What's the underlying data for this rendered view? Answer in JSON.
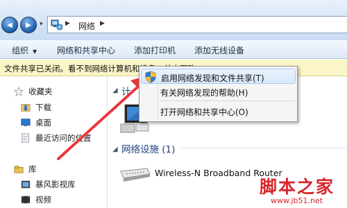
{
  "address_bar": {
    "back_glyph": "◀",
    "forward_glyph": "▶",
    "dropdown_glyph": "▾",
    "location_icon": "network-icon",
    "crumbs": [
      "网络"
    ],
    "separator": "▶"
  },
  "toolbar": {
    "items": [
      {
        "label": "组织",
        "has_dropdown": true
      },
      {
        "label": "网络和共享中心"
      },
      {
        "label": "添加打印机"
      },
      {
        "label": "添加无线设备"
      }
    ],
    "dropdown_glyph": "▼"
  },
  "infobar": {
    "text": "文件共享已关闭。看不到网络计算机和设备。单击更改..."
  },
  "nav": {
    "favorites": {
      "label": "收藏夹",
      "icon": "star-icon"
    },
    "items": [
      {
        "label": "下载",
        "icon": "download-folder-icon"
      },
      {
        "label": "桌面",
        "icon": "desktop-icon"
      },
      {
        "label": "最近访问的位置",
        "icon": "recent-places-icon"
      }
    ],
    "library": {
      "label": "库",
      "icon": "library-icon"
    },
    "library_items": [
      {
        "label": "暴风影视库",
        "icon": "video-library-icon"
      },
      {
        "label": "视频",
        "icon": "video-icon"
      }
    ]
  },
  "content": {
    "group1_title": "计",
    "group2_title": "网络设施 (1)",
    "device_name": "Wireless-N Broadband Router",
    "caret": "◢"
  },
  "context_menu": {
    "items": [
      {
        "label": "启用网络发现和文件共享(T)",
        "icon": "uac-shield-icon",
        "highlighted": true
      },
      {
        "label": "有关网络发现的帮助(H)"
      },
      {
        "label": "打开网络和共享中心(O)"
      }
    ]
  },
  "watermark": {
    "brand": "脚本之家",
    "url": "www.jb51.net"
  },
  "colors": {
    "arrow": "#e8373b",
    "watermark": "#d9262b",
    "infobar_bg": "#fbf6c8",
    "menu_highlight": "#d7e8fb"
  }
}
